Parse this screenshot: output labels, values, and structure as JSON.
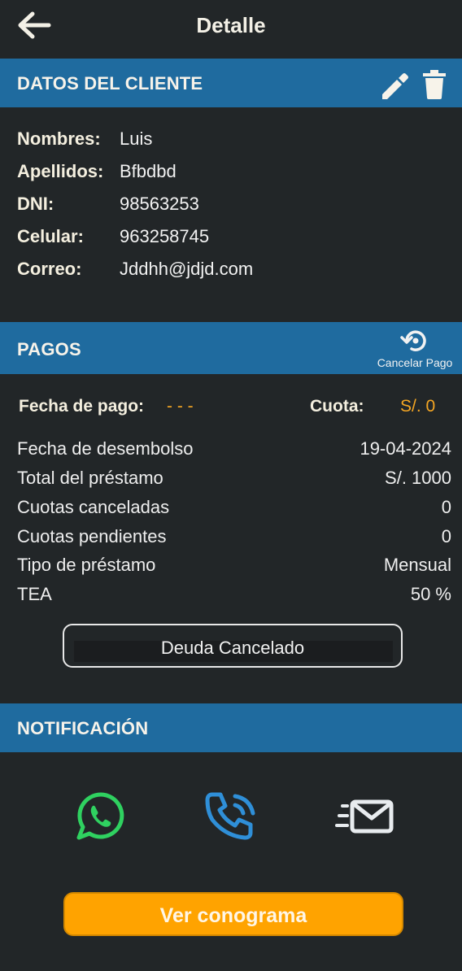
{
  "header": {
    "title": "Detalle"
  },
  "client_section": {
    "title": "DATOS DEL CLIENTE",
    "fields": [
      {
        "label": "Nombres:",
        "value": "Luis"
      },
      {
        "label": "Apellidos:",
        "value": "Bfbdbd"
      },
      {
        "label": "DNI:",
        "value": "98563253"
      },
      {
        "label": "Celular:",
        "value": "963258745"
      },
      {
        "label": "Correo:",
        "value": "Jddhh@jdjd.com"
      }
    ]
  },
  "payments_section": {
    "title": "PAGOS",
    "cancel_payment_label": "Cancelar Pago",
    "payment_date_label": "Fecha de pago:",
    "payment_date_value": "- - -",
    "installment_label": "Cuota:",
    "installment_value": "S/. 0",
    "details": [
      {
        "label": "Fecha de desembolso",
        "value": "19-04-2024"
      },
      {
        "label": "Total del préstamo",
        "value": "S/. 1000"
      },
      {
        "label": "Cuotas canceladas",
        "value": "0"
      },
      {
        "label": "Cuotas pendientes",
        "value": "0"
      },
      {
        "label": "Tipo de préstamo",
        "value": "Mensual"
      },
      {
        "label": "TEA",
        "value": "50 %"
      }
    ],
    "debt_button_label": "Deuda Cancelado"
  },
  "notification_section": {
    "title": "NOTIFICACIÓN"
  },
  "schedule_button_label": "Ver conograma",
  "colors": {
    "background": "#222628",
    "section_header": "#1f6b9f",
    "accent_orange": "#ffa300",
    "whatsapp_green": "#2fd160",
    "phone_blue": "#2f8fd8"
  },
  "icons": [
    "arrow-back-icon",
    "pencil-icon",
    "trash-icon",
    "restore-icon",
    "whatsapp-icon",
    "phone-call-icon",
    "email-send-icon"
  ]
}
